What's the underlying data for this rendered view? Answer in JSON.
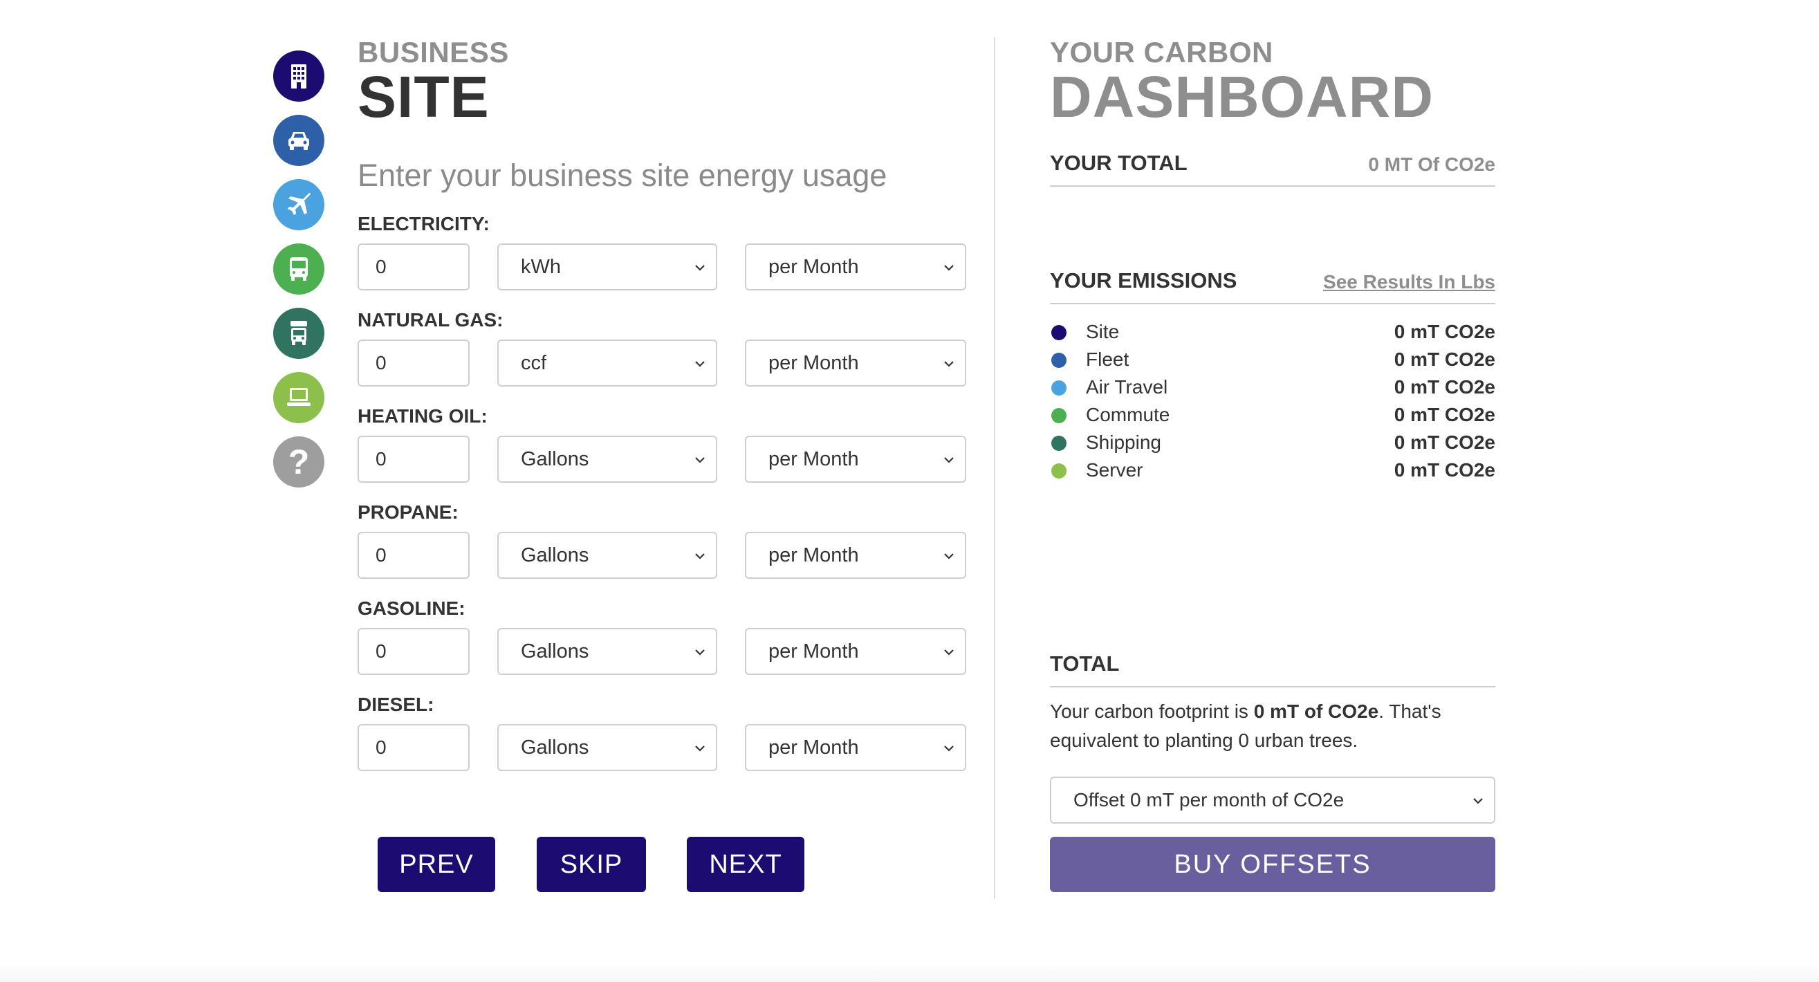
{
  "colors": {
    "site": "#1c0b70",
    "fleet": "#2e5fa9",
    "air_travel": "#4aa3df",
    "commute": "#4caf50",
    "shipping": "#2f7360",
    "server": "#8dc04a",
    "help": "#9e9e9e",
    "button": "#1c0b70",
    "buy_button": "#6a5f9e"
  },
  "sidebar": {
    "items": [
      {
        "name": "site",
        "icon": "building-icon"
      },
      {
        "name": "fleet",
        "icon": "car-icon"
      },
      {
        "name": "air-travel",
        "icon": "airplane-icon"
      },
      {
        "name": "commute",
        "icon": "bus-icon"
      },
      {
        "name": "shipping",
        "icon": "truck-icon"
      },
      {
        "name": "server",
        "icon": "laptop-icon"
      },
      {
        "name": "help",
        "icon": "question-icon",
        "glyph": "?"
      }
    ]
  },
  "left": {
    "kicker": "BUSINESS",
    "title": "SITE",
    "instructions": "Enter your business site energy usage",
    "fields": [
      {
        "label": "ELECTRICITY:",
        "value": "0",
        "unit": "kWh",
        "period": "per Month"
      },
      {
        "label": "NATURAL GAS:",
        "value": "0",
        "unit": "ccf",
        "period": "per Month"
      },
      {
        "label": "HEATING OIL:",
        "value": "0",
        "unit": "Gallons",
        "period": "per Month"
      },
      {
        "label": "PROPANE:",
        "value": "0",
        "unit": "Gallons",
        "period": "per Month"
      },
      {
        "label": "GASOLINE:",
        "value": "0",
        "unit": "Gallons",
        "period": "per Month"
      },
      {
        "label": "DIESEL:",
        "value": "0",
        "unit": "Gallons",
        "period": "per Month"
      }
    ],
    "buttons": {
      "prev": "PREV",
      "skip": "SKIP",
      "next": "NEXT"
    }
  },
  "right": {
    "kicker": "YOUR CARBON",
    "title": "DASHBOARD",
    "total_label": "YOUR TOTAL",
    "total_value": "0 MT Of CO2e",
    "emissions_label": "YOUR EMISSIONS",
    "see_lbs": "See Results In Lbs",
    "emissions": [
      {
        "name": "Site",
        "value": "0 mT CO2e"
      },
      {
        "name": "Fleet",
        "value": "0 mT CO2e"
      },
      {
        "name": "Air Travel",
        "value": "0 mT CO2e"
      },
      {
        "name": "Commute",
        "value": "0 mT CO2e"
      },
      {
        "name": "Shipping",
        "value": "0 mT CO2e"
      },
      {
        "name": "Server",
        "value": "0 mT CO2e"
      }
    ],
    "total_heading": "TOTAL",
    "footprint": {
      "prefix": "Your carbon footprint is ",
      "amount": "0 mT of CO2e",
      "suffix": ". That's equivalent to planting 0 urban trees."
    },
    "offset_option": "Offset 0 mT per month of CO2e",
    "buy_label": "BUY OFFSETS"
  }
}
